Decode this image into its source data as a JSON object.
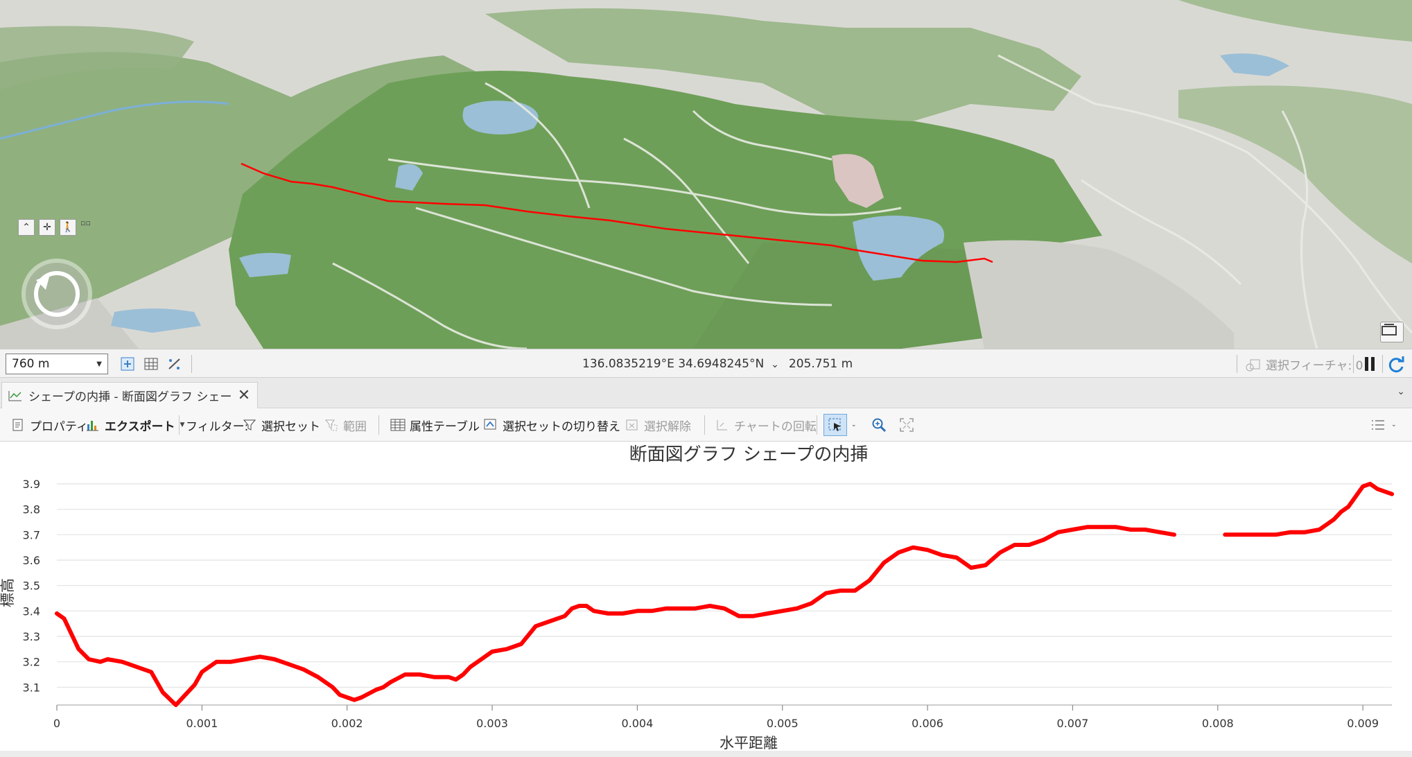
{
  "map": {
    "scale_value": "760 m",
    "profile_line_color": "#ff0000",
    "water_color": "#9bbfd6",
    "park_color": "#6fa05a",
    "land_color": "#d8d8d3"
  },
  "statusbar": {
    "coordinates": "136.0835219°E 34.6948245°N",
    "elevation": "205.751 m",
    "selected_features": "選択フィーチャ: 0"
  },
  "tab": {
    "label": "シェープの内挿 - 断面図グラフ シェープの..."
  },
  "ribbon": {
    "properties": "プロパティ",
    "export": "エクスポート",
    "filter_label": "フィルター:",
    "selection_set": "選択セット",
    "extent": "範囲",
    "attribute_table": "属性テーブル",
    "switch_selection": "選択セットの切り替え",
    "clear_selection": "選択解除",
    "rotate_chart": "チャートの回転"
  },
  "chart_data": {
    "type": "line",
    "title": "断面図グラフ シェープの内挿",
    "xlabel": "水平距離",
    "ylabel": "標高",
    "xlim": [
      0,
      0.0092
    ],
    "ylim": [
      3.03,
      3.93
    ],
    "xticks": [
      "0",
      "0.001",
      "0.002",
      "0.003",
      "0.004",
      "0.005",
      "0.006",
      "0.007",
      "0.008",
      "0.009"
    ],
    "yticks": [
      "3.1",
      "3.2",
      "3.3",
      "3.4",
      "3.5",
      "3.6",
      "3.7",
      "3.8",
      "3.9"
    ],
    "grid": "horizontal",
    "series_color": "#ff0000",
    "series": [
      {
        "segments": [
          [
            [
              0.0,
              3.39
            ],
            [
              5e-05,
              3.37
            ],
            [
              0.00015,
              3.25
            ],
            [
              0.00022,
              3.21
            ],
            [
              0.0003,
              3.2
            ],
            [
              0.00035,
              3.21
            ],
            [
              0.00045,
              3.2
            ],
            [
              0.0005,
              3.19
            ],
            [
              0.0006,
              3.17
            ],
            [
              0.00065,
              3.16
            ],
            [
              0.00073,
              3.08
            ],
            [
              0.00082,
              3.03
            ],
            [
              0.00095,
              3.11
            ],
            [
              0.001,
              3.16
            ],
            [
              0.0011,
              3.2
            ],
            [
              0.0012,
              3.2
            ],
            [
              0.0013,
              3.21
            ],
            [
              0.0014,
              3.22
            ],
            [
              0.0015,
              3.21
            ],
            [
              0.0016,
              3.19
            ],
            [
              0.0017,
              3.17
            ],
            [
              0.0018,
              3.14
            ],
            [
              0.0019,
              3.1
            ],
            [
              0.00195,
              3.07
            ],
            [
              0.00205,
              3.05
            ],
            [
              0.0021,
              3.06
            ],
            [
              0.0022,
              3.09
            ],
            [
              0.00225,
              3.1
            ],
            [
              0.0023,
              3.12
            ],
            [
              0.0024,
              3.15
            ],
            [
              0.0025,
              3.15
            ],
            [
              0.0026,
              3.14
            ],
            [
              0.0027,
              3.14
            ],
            [
              0.00275,
              3.13
            ],
            [
              0.0028,
              3.15
            ],
            [
              0.00285,
              3.18
            ],
            [
              0.0029,
              3.2
            ],
            [
              0.003,
              3.24
            ],
            [
              0.0031,
              3.25
            ],
            [
              0.0032,
              3.27
            ],
            [
              0.0033,
              3.34
            ],
            [
              0.0034,
              3.36
            ],
            [
              0.0035,
              3.38
            ],
            [
              0.00355,
              3.41
            ],
            [
              0.0036,
              3.42
            ],
            [
              0.00365,
              3.42
            ],
            [
              0.0037,
              3.4
            ],
            [
              0.0038,
              3.39
            ],
            [
              0.0039,
              3.39
            ],
            [
              0.004,
              3.4
            ],
            [
              0.0041,
              3.4
            ],
            [
              0.0042,
              3.41
            ],
            [
              0.0043,
              3.41
            ],
            [
              0.0044,
              3.41
            ],
            [
              0.0045,
              3.42
            ],
            [
              0.0046,
              3.41
            ],
            [
              0.0047,
              3.38
            ],
            [
              0.0048,
              3.38
            ],
            [
              0.0049,
              3.39
            ],
            [
              0.005,
              3.4
            ],
            [
              0.0051,
              3.41
            ],
            [
              0.0052,
              3.43
            ],
            [
              0.0053,
              3.47
            ],
            [
              0.0054,
              3.48
            ],
            [
              0.0055,
              3.48
            ],
            [
              0.0056,
              3.52
            ],
            [
              0.0057,
              3.59
            ],
            [
              0.0058,
              3.63
            ],
            [
              0.0059,
              3.65
            ],
            [
              0.006,
              3.64
            ],
            [
              0.0061,
              3.62
            ],
            [
              0.0062,
              3.61
            ],
            [
              0.0063,
              3.57
            ],
            [
              0.0064,
              3.58
            ],
            [
              0.0065,
              3.63
            ],
            [
              0.0066,
              3.66
            ],
            [
              0.0067,
              3.66
            ],
            [
              0.0068,
              3.68
            ],
            [
              0.0069,
              3.71
            ],
            [
              0.007,
              3.72
            ],
            [
              0.0071,
              3.73
            ],
            [
              0.0072,
              3.73
            ],
            [
              0.0073,
              3.73
            ],
            [
              0.0074,
              3.72
            ],
            [
              0.0075,
              3.72
            ],
            [
              0.0076,
              3.71
            ],
            [
              0.0077,
              3.7
            ]
          ],
          [
            [
              0.00805,
              3.7
            ],
            [
              0.0082,
              3.7
            ],
            [
              0.0083,
              3.7
            ],
            [
              0.0084,
              3.7
            ],
            [
              0.0085,
              3.71
            ],
            [
              0.0086,
              3.71
            ],
            [
              0.0087,
              3.72
            ],
            [
              0.00875,
              3.74
            ],
            [
              0.0088,
              3.76
            ],
            [
              0.00885,
              3.79
            ],
            [
              0.0089,
              3.81
            ],
            [
              0.00895,
              3.85
            ],
            [
              0.009,
              3.89
            ],
            [
              0.00905,
              3.9
            ],
            [
              0.0091,
              3.88
            ],
            [
              0.0092,
              3.86
            ]
          ]
        ]
      }
    ]
  }
}
